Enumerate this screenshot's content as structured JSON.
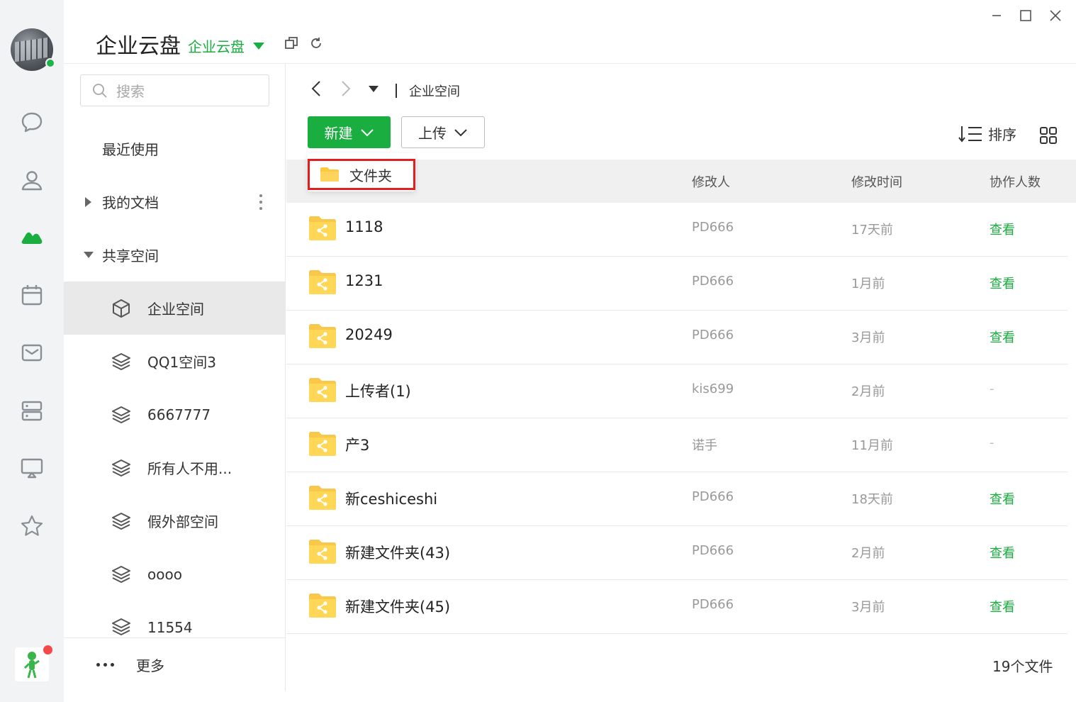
{
  "app": {
    "title": "企业云盘",
    "switcher_label": "企业云盘"
  },
  "colors": {
    "accent": "#1aad3f",
    "highlight_border": "#e0201e",
    "online": "#20b24c",
    "notify": "#f5484b"
  },
  "rail": {
    "items": [
      "chat-icon",
      "contacts-icon",
      "cloud-drive-icon",
      "calendar-icon",
      "mail-icon",
      "workbench-icon",
      "meeting-icon",
      "favorites-icon"
    ],
    "active": "cloud-drive-icon"
  },
  "search": {
    "placeholder": "搜索"
  },
  "sidebar": {
    "recent": "最近使用",
    "my_docs": "我的文档",
    "shared": "共享空间",
    "spaces": [
      {
        "label": "企业空间",
        "icon": "cube-icon"
      },
      {
        "label": "QQ1空间3",
        "icon": "layers-icon"
      },
      {
        "label": "6667777",
        "icon": "layers-icon"
      },
      {
        "label": "所有人不用...",
        "icon": "layers-icon"
      },
      {
        "label": "假外部空间",
        "icon": "layers-icon"
      },
      {
        "label": "oooo",
        "icon": "layers-icon"
      },
      {
        "label": "11554",
        "icon": "layers-icon"
      }
    ],
    "more": "更多"
  },
  "breadcrumb": {
    "current": "企业空间"
  },
  "toolbar": {
    "new_label": "新建",
    "upload_label": "上传",
    "sort_label": "排序"
  },
  "dropdown": {
    "item": "文件夹"
  },
  "table": {
    "headers": {
      "modifier": "修改人",
      "modified_time": "修改时间",
      "collaborators": "协作人数"
    },
    "rows": [
      {
        "name": "1118",
        "modifier": "PD666",
        "time": "17天前",
        "collab": "查看"
      },
      {
        "name": "1231",
        "modifier": "PD666",
        "time": "1月前",
        "collab": "查看"
      },
      {
        "name": "20249",
        "modifier": "PD666",
        "time": "3月前",
        "collab": "查看"
      },
      {
        "name": "上传者(1)",
        "modifier": "kis699",
        "time": "2月前",
        "collab": "-"
      },
      {
        "name": "产3",
        "modifier": "诺手",
        "time": "11月前",
        "collab": "-"
      },
      {
        "name": "新ceshiceshi",
        "modifier": "PD666",
        "time": "18天前",
        "collab": "查看"
      },
      {
        "name": "新建文件夹(43)",
        "modifier": "PD666",
        "time": "2月前",
        "collab": "查看"
      },
      {
        "name": "新建文件夹(45)",
        "modifier": "PD666",
        "time": "3月前",
        "collab": "查看"
      }
    ]
  },
  "footer": {
    "file_count": "19个文件"
  }
}
